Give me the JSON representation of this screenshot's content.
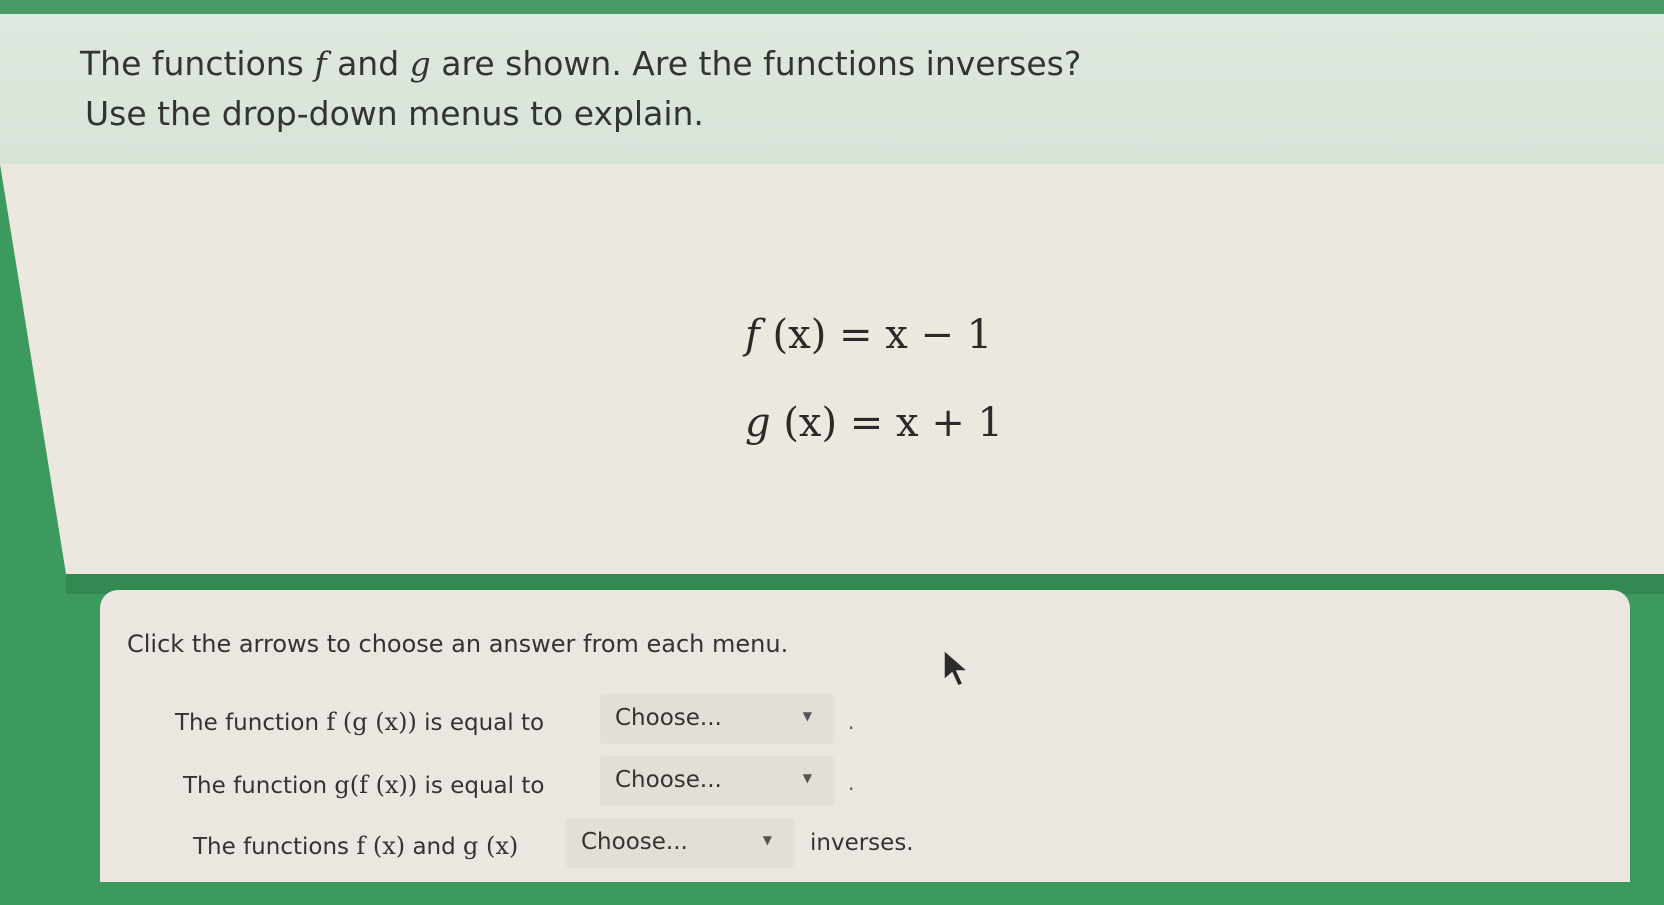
{
  "question": {
    "line1_part1": "The functions ",
    "f": "f",
    "line1_and": " and ",
    "g": "g",
    "line1_part2": " are shown. Are the functions inverses?",
    "line2": "Use the drop-down menus to explain."
  },
  "equations": {
    "f_name": "f",
    "f_rest": " (x) = x − 1",
    "g_name": "g",
    "g_rest": " (x) = x + 1"
  },
  "answer_card": {
    "instruction": "Click the arrows to choose an answer from each menu.",
    "row1": {
      "prefix": "The function",
      "expr": "f (g (x))",
      "suffix": "is equal to",
      "after": "."
    },
    "row2": {
      "prefix": "The function",
      "expr": "g(f (x))",
      "suffix": "is equal to",
      "after": "."
    },
    "row3": {
      "prefix": "The functions",
      "expr1": "f (x)",
      "mid": "and",
      "expr2": "g (x)",
      "after": "inverses."
    },
    "dropdowns": [
      {
        "selected": "Choose..."
      },
      {
        "selected": "Choose..."
      },
      {
        "selected": "Choose..."
      }
    ],
    "arrow_glyph": "▼"
  },
  "icons": {
    "cursor": "mouse-pointer-icon"
  },
  "colors": {
    "background_green": "#3d9a5e",
    "panel": "#ece7df",
    "header": "#dfe8de",
    "dropdown": "#e3ded6"
  }
}
